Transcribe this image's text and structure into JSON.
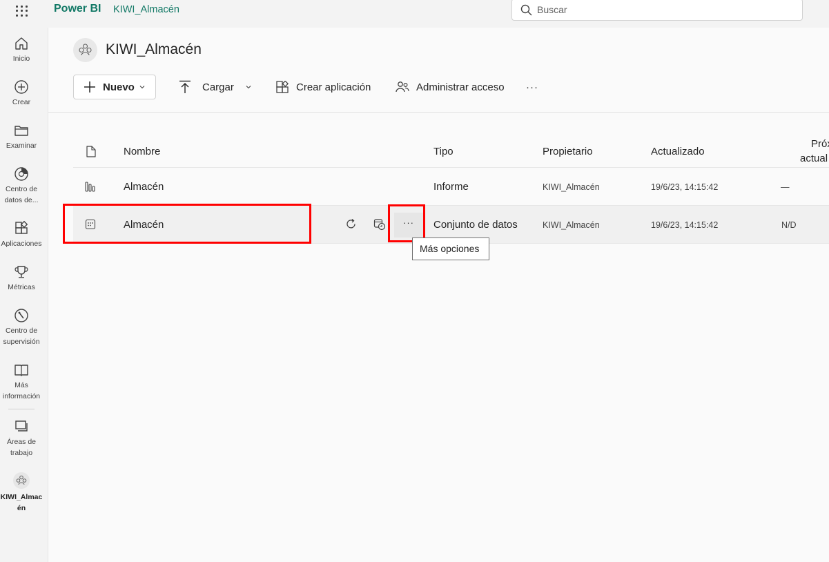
{
  "topbar": {
    "brand": "Power BI",
    "breadcrumb": "KIWI_Almacén",
    "search_placeholder": "Buscar"
  },
  "rail": {
    "items": [
      {
        "label": "Inicio",
        "icon": "home-icon"
      },
      {
        "label": "Crear",
        "icon": "plus-circle-icon"
      },
      {
        "label": "Examinar",
        "icon": "folder-icon"
      },
      {
        "label": "Centro de datos de...",
        "icon": "data-hub-icon"
      },
      {
        "label": "Aplicaciones",
        "icon": "apps-icon"
      },
      {
        "label": "Métricas",
        "icon": "trophy-icon"
      },
      {
        "label": "Centro de supervisión",
        "icon": "monitor-hub-icon"
      },
      {
        "label": "Más información",
        "icon": "book-icon"
      },
      {
        "label": "Áreas de trabajo",
        "icon": "workspaces-icon"
      },
      {
        "label": "KIWI_Almacén",
        "icon": "workspace-icon"
      }
    ]
  },
  "workspace": {
    "title": "KIWI_Almacén"
  },
  "toolbar": {
    "nuevo": "Nuevo",
    "cargar": "Cargar",
    "crear_aplicacion": "Crear aplicación",
    "administrar_acceso": "Administrar acceso",
    "more": "···"
  },
  "table": {
    "headers": {
      "nombre": "Nombre",
      "tipo": "Tipo",
      "propietario": "Propietario",
      "actualizado": "Actualizado",
      "proxima_1": "Próx",
      "proxima_2": "actual"
    },
    "rows": [
      {
        "nombre": "Almacén",
        "tipo": "Informe",
        "propietario": "KIWI_Almacén",
        "actualizado": "19/6/23, 14:15:42",
        "proxima": "—"
      },
      {
        "nombre": "Almacén",
        "tipo": "Conjunto de datos",
        "propietario": "KIWI_Almacén",
        "actualizado": "19/6/23, 14:15:42",
        "proxima": "N/D",
        "more": "···"
      }
    ]
  },
  "tooltip": {
    "text": "Más opciones"
  },
  "colors": {
    "brand": "#117865",
    "highlight": "#ff0000"
  }
}
